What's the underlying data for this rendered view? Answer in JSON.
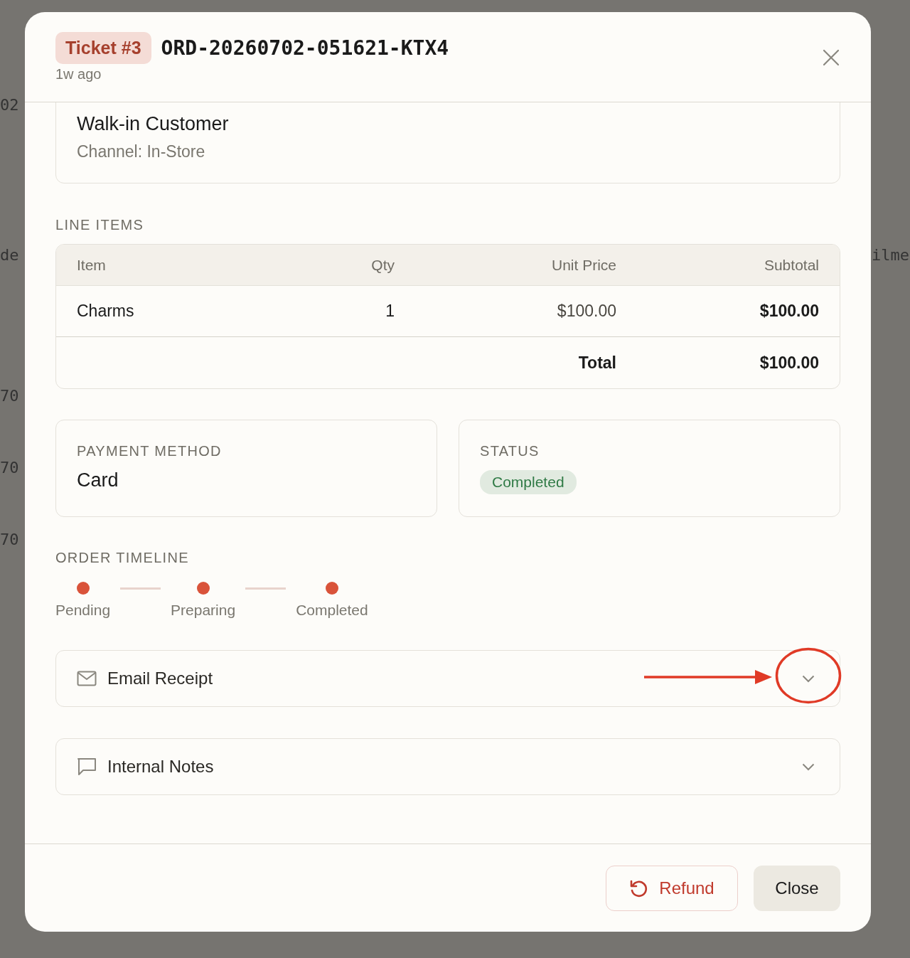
{
  "background_fragments": [
    "02",
    "de",
    "ilme",
    "70",
    "70",
    "70"
  ],
  "dialog": {
    "ticket_badge": "Ticket #3",
    "order_id": "ORD-20260702-051621-KTX4",
    "age": "1w ago"
  },
  "customer": {
    "name": "Walk-in Customer",
    "channel": "Channel: In-Store"
  },
  "line_items": {
    "heading": "LINE ITEMS",
    "columns": [
      "Item",
      "Qty",
      "Unit Price",
      "Subtotal"
    ],
    "rows": [
      [
        "Charms",
        "1",
        "$100.00",
        "$100.00"
      ]
    ],
    "total_label": "Total",
    "total_value": "$100.00"
  },
  "payment": {
    "heading": "PAYMENT METHOD",
    "value": "Card"
  },
  "status": {
    "heading": "STATUS",
    "value": "Completed",
    "color": "#2f7a45"
  },
  "timeline": {
    "heading": "ORDER TIMELINE",
    "steps": [
      {
        "label": "Pending",
        "done": true
      },
      {
        "label": "Preparing",
        "done": true
      },
      {
        "label": "Completed",
        "done": true
      }
    ]
  },
  "sections": [
    {
      "kind": "email",
      "label": "Email Receipt",
      "expanded": false,
      "highlighted": true
    },
    {
      "kind": "notes",
      "label": "Internal Notes",
      "expanded": false,
      "highlighted": false
    }
  ],
  "footer": {
    "buttons": [
      {
        "kind": "refund",
        "label": "Refund"
      },
      {
        "kind": "close",
        "label": "Close"
      }
    ]
  }
}
